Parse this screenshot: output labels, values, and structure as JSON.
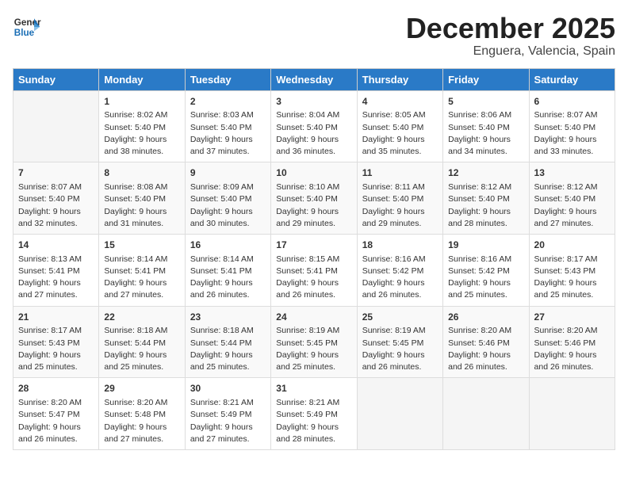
{
  "header": {
    "logo_line1": "General",
    "logo_line2": "Blue",
    "month": "December 2025",
    "location": "Enguera, Valencia, Spain"
  },
  "days_of_week": [
    "Sunday",
    "Monday",
    "Tuesday",
    "Wednesday",
    "Thursday",
    "Friday",
    "Saturday"
  ],
  "weeks": [
    [
      {
        "day": "",
        "sunrise": "",
        "sunset": "",
        "daylight": ""
      },
      {
        "day": "1",
        "sunrise": "Sunrise: 8:02 AM",
        "sunset": "Sunset: 5:40 PM",
        "daylight": "Daylight: 9 hours and 38 minutes."
      },
      {
        "day": "2",
        "sunrise": "Sunrise: 8:03 AM",
        "sunset": "Sunset: 5:40 PM",
        "daylight": "Daylight: 9 hours and 37 minutes."
      },
      {
        "day": "3",
        "sunrise": "Sunrise: 8:04 AM",
        "sunset": "Sunset: 5:40 PM",
        "daylight": "Daylight: 9 hours and 36 minutes."
      },
      {
        "day": "4",
        "sunrise": "Sunrise: 8:05 AM",
        "sunset": "Sunset: 5:40 PM",
        "daylight": "Daylight: 9 hours and 35 minutes."
      },
      {
        "day": "5",
        "sunrise": "Sunrise: 8:06 AM",
        "sunset": "Sunset: 5:40 PM",
        "daylight": "Daylight: 9 hours and 34 minutes."
      },
      {
        "day": "6",
        "sunrise": "Sunrise: 8:07 AM",
        "sunset": "Sunset: 5:40 PM",
        "daylight": "Daylight: 9 hours and 33 minutes."
      }
    ],
    [
      {
        "day": "7",
        "sunrise": "Sunrise: 8:07 AM",
        "sunset": "Sunset: 5:40 PM",
        "daylight": "Daylight: 9 hours and 32 minutes."
      },
      {
        "day": "8",
        "sunrise": "Sunrise: 8:08 AM",
        "sunset": "Sunset: 5:40 PM",
        "daylight": "Daylight: 9 hours and 31 minutes."
      },
      {
        "day": "9",
        "sunrise": "Sunrise: 8:09 AM",
        "sunset": "Sunset: 5:40 PM",
        "daylight": "Daylight: 9 hours and 30 minutes."
      },
      {
        "day": "10",
        "sunrise": "Sunrise: 8:10 AM",
        "sunset": "Sunset: 5:40 PM",
        "daylight": "Daylight: 9 hours and 29 minutes."
      },
      {
        "day": "11",
        "sunrise": "Sunrise: 8:11 AM",
        "sunset": "Sunset: 5:40 PM",
        "daylight": "Daylight: 9 hours and 29 minutes."
      },
      {
        "day": "12",
        "sunrise": "Sunrise: 8:12 AM",
        "sunset": "Sunset: 5:40 PM",
        "daylight": "Daylight: 9 hours and 28 minutes."
      },
      {
        "day": "13",
        "sunrise": "Sunrise: 8:12 AM",
        "sunset": "Sunset: 5:40 PM",
        "daylight": "Daylight: 9 hours and 27 minutes."
      }
    ],
    [
      {
        "day": "14",
        "sunrise": "Sunrise: 8:13 AM",
        "sunset": "Sunset: 5:41 PM",
        "daylight": "Daylight: 9 hours and 27 minutes."
      },
      {
        "day": "15",
        "sunrise": "Sunrise: 8:14 AM",
        "sunset": "Sunset: 5:41 PM",
        "daylight": "Daylight: 9 hours and 27 minutes."
      },
      {
        "day": "16",
        "sunrise": "Sunrise: 8:14 AM",
        "sunset": "Sunset: 5:41 PM",
        "daylight": "Daylight: 9 hours and 26 minutes."
      },
      {
        "day": "17",
        "sunrise": "Sunrise: 8:15 AM",
        "sunset": "Sunset: 5:41 PM",
        "daylight": "Daylight: 9 hours and 26 minutes."
      },
      {
        "day": "18",
        "sunrise": "Sunrise: 8:16 AM",
        "sunset": "Sunset: 5:42 PM",
        "daylight": "Daylight: 9 hours and 26 minutes."
      },
      {
        "day": "19",
        "sunrise": "Sunrise: 8:16 AM",
        "sunset": "Sunset: 5:42 PM",
        "daylight": "Daylight: 9 hours and 25 minutes."
      },
      {
        "day": "20",
        "sunrise": "Sunrise: 8:17 AM",
        "sunset": "Sunset: 5:43 PM",
        "daylight": "Daylight: 9 hours and 25 minutes."
      }
    ],
    [
      {
        "day": "21",
        "sunrise": "Sunrise: 8:17 AM",
        "sunset": "Sunset: 5:43 PM",
        "daylight": "Daylight: 9 hours and 25 minutes."
      },
      {
        "day": "22",
        "sunrise": "Sunrise: 8:18 AM",
        "sunset": "Sunset: 5:44 PM",
        "daylight": "Daylight: 9 hours and 25 minutes."
      },
      {
        "day": "23",
        "sunrise": "Sunrise: 8:18 AM",
        "sunset": "Sunset: 5:44 PM",
        "daylight": "Daylight: 9 hours and 25 minutes."
      },
      {
        "day": "24",
        "sunrise": "Sunrise: 8:19 AM",
        "sunset": "Sunset: 5:45 PM",
        "daylight": "Daylight: 9 hours and 25 minutes."
      },
      {
        "day": "25",
        "sunrise": "Sunrise: 8:19 AM",
        "sunset": "Sunset: 5:45 PM",
        "daylight": "Daylight: 9 hours and 26 minutes."
      },
      {
        "day": "26",
        "sunrise": "Sunrise: 8:20 AM",
        "sunset": "Sunset: 5:46 PM",
        "daylight": "Daylight: 9 hours and 26 minutes."
      },
      {
        "day": "27",
        "sunrise": "Sunrise: 8:20 AM",
        "sunset": "Sunset: 5:46 PM",
        "daylight": "Daylight: 9 hours and 26 minutes."
      }
    ],
    [
      {
        "day": "28",
        "sunrise": "Sunrise: 8:20 AM",
        "sunset": "Sunset: 5:47 PM",
        "daylight": "Daylight: 9 hours and 26 minutes."
      },
      {
        "day": "29",
        "sunrise": "Sunrise: 8:20 AM",
        "sunset": "Sunset: 5:48 PM",
        "daylight": "Daylight: 9 hours and 27 minutes."
      },
      {
        "day": "30",
        "sunrise": "Sunrise: 8:21 AM",
        "sunset": "Sunset: 5:49 PM",
        "daylight": "Daylight: 9 hours and 27 minutes."
      },
      {
        "day": "31",
        "sunrise": "Sunrise: 8:21 AM",
        "sunset": "Sunset: 5:49 PM",
        "daylight": "Daylight: 9 hours and 28 minutes."
      },
      {
        "day": "",
        "sunrise": "",
        "sunset": "",
        "daylight": ""
      },
      {
        "day": "",
        "sunrise": "",
        "sunset": "",
        "daylight": ""
      },
      {
        "day": "",
        "sunrise": "",
        "sunset": "",
        "daylight": ""
      }
    ]
  ]
}
